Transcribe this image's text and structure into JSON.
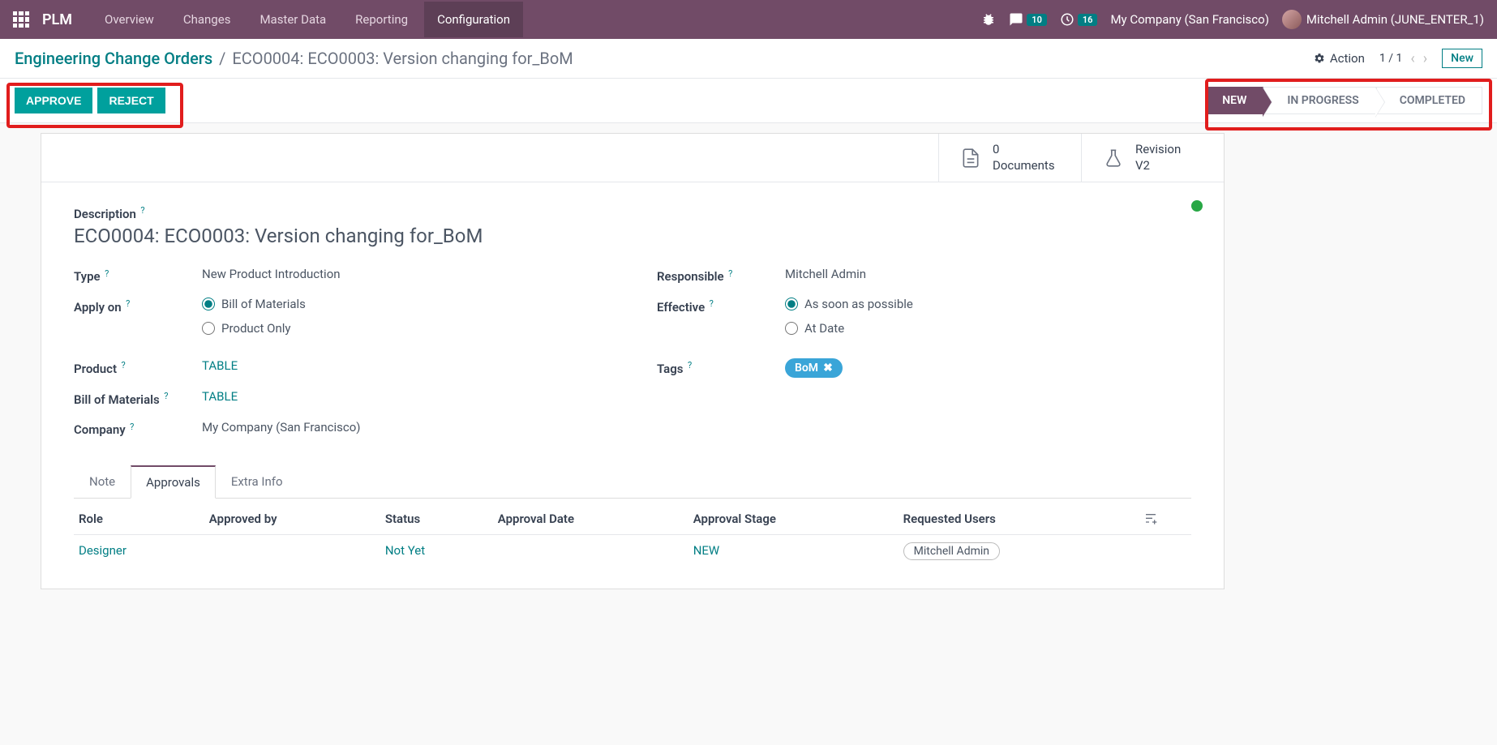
{
  "nav": {
    "brand": "PLM",
    "items": [
      "Overview",
      "Changes",
      "Master Data",
      "Reporting",
      "Configuration"
    ],
    "active_index": 4,
    "messages_badge": "10",
    "activities_badge": "16",
    "company": "My Company (San Francisco)",
    "user": "Mitchell Admin (JUNE_ENTER_1)"
  },
  "breadcrumb": {
    "root": "Engineering Change Orders",
    "current": "ECO0004: ECO0003: Version changing for_BoM"
  },
  "controls": {
    "action_label": "Action",
    "pager": "1 / 1",
    "new_label": "New"
  },
  "buttons": {
    "approve": "APPROVE",
    "reject": "REJECT"
  },
  "stages": {
    "items": [
      "NEW",
      "IN PROGRESS",
      "COMPLETED"
    ],
    "active_index": 0
  },
  "stat_buttons": {
    "documents_count": "0",
    "documents_label": "Documents",
    "revision_label": "Revision",
    "revision_value": "V2"
  },
  "form": {
    "description_label": "Description",
    "description_value": "ECO0004: ECO0003: Version changing for_BoM",
    "type_label": "Type",
    "type_value": "New Product Introduction",
    "apply_on_label": "Apply on",
    "apply_on_option1": "Bill of Materials",
    "apply_on_option2": "Product Only",
    "product_label": "Product",
    "product_value": "TABLE",
    "bom_label": "Bill of Materials",
    "bom_value": "TABLE",
    "company_label": "Company",
    "company_value": "My Company (San Francisco)",
    "responsible_label": "Responsible",
    "responsible_value": "Mitchell Admin",
    "effective_label": "Effective",
    "effective_option1": "As soon as possible",
    "effective_option2": "At Date",
    "tags_label": "Tags",
    "tag_value": "BoM"
  },
  "tabs": {
    "items": [
      "Note",
      "Approvals",
      "Extra Info"
    ],
    "active_index": 1
  },
  "approvals": {
    "headers": {
      "role": "Role",
      "approved_by": "Approved by",
      "status": "Status",
      "approval_date": "Approval Date",
      "approval_stage": "Approval Stage",
      "requested_users": "Requested Users"
    },
    "row": {
      "role": "Designer",
      "approved_by": "",
      "status": "Not Yet",
      "approval_date": "",
      "approval_stage": "NEW",
      "requested_user": "Mitchell Admin"
    }
  }
}
